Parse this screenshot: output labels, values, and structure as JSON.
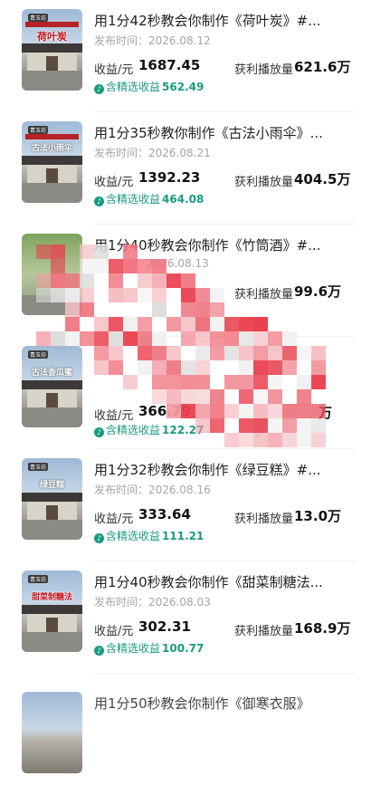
{
  "items": [
    {
      "title": "用1分42秒教会你制作《荷叶炭》#...",
      "date": "发布时间：2026.08.12",
      "income_label": "收益/元",
      "income": "1687.45",
      "select_label": "含精选收益",
      "select_income": "562.49",
      "plays_label": "获利播放量",
      "plays": "621.6万",
      "thumb_badge": "青玉坊",
      "thumb_text": "荷叶炭"
    },
    {
      "title": "用1分35秒教你制作《古法小雨伞》...",
      "date": "发布时间：2026.08.21",
      "income_label": "收益/元",
      "income": "1392.23",
      "select_label": "含精选收益",
      "select_income": "464.08",
      "plays_label": "获利播放量",
      "plays": "404.5万",
      "thumb_badge": "青玉坊",
      "thumb_text": "古法小雨伞"
    },
    {
      "title": "用1分40秒教会你制作《竹筒酒》#...",
      "date": "2026.08.13",
      "income_label": "",
      "income": "",
      "select_label": "",
      "select_income": "",
      "plays_label": "获利播放量",
      "plays": "99.6万",
      "thumb_badge": "",
      "thumb_text": ""
    },
    {
      "title": "",
      "date": "",
      "income_label": "收益/元",
      "income": "366.79",
      "select_label": "含精选收益",
      "select_income": "122.27",
      "plays_label": "",
      "plays": "万",
      "thumb_badge": "青玉坊",
      "thumb_text": "古法香瓜蜜"
    },
    {
      "title": "用1分32秒教会你制作《绿豆糕》#...",
      "date": "发布时间：2026.08.16",
      "income_label": "收益/元",
      "income": "333.64",
      "select_label": "含精选收益",
      "select_income": "111.21",
      "plays_label": "获利播放量",
      "plays": "13.0万",
      "thumb_badge": "青玉坊",
      "thumb_text": "绿豆糕"
    },
    {
      "title": "用1分40秒教会你制作《甜菜制糖法...",
      "date": "发布时间：2026.08.03",
      "income_label": "收益/元",
      "income": "302.31",
      "select_label": "含精选收益",
      "select_income": "100.77",
      "plays_label": "获利播放量",
      "plays": "168.9万",
      "thumb_badge": "青玉坊",
      "thumb_text": "甜菜制糖法"
    },
    {
      "title": "用1分50秒教会你制作《御寒衣服》",
      "date": "",
      "income_label": "",
      "income": "",
      "select_label": "",
      "select_income": "",
      "plays_label": "",
      "plays": "",
      "thumb_badge": "",
      "thumb_text": ""
    }
  ],
  "icons": {
    "select": "douyin-icon"
  },
  "colors": {
    "accent": "#1a9a80",
    "pixelation": "#e8505d"
  }
}
